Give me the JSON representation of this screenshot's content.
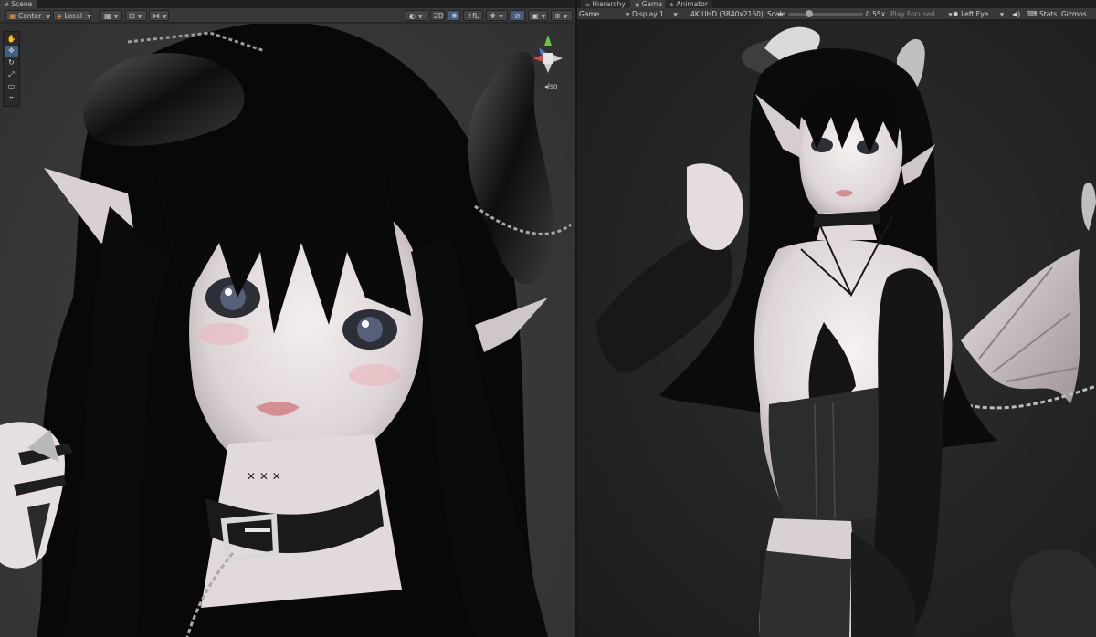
{
  "scene_tabbar": {
    "tab_scene": "Scene"
  },
  "scene_toolbar": {
    "pivot_label": "Center",
    "space_label": "Local",
    "mode_2d": "2D",
    "fx_label": "↑fL"
  },
  "gizmo": {
    "projection_label": "Iso"
  },
  "game_tabbar": {
    "tab_hierarchy": "Hierarchy",
    "tab_game": "Game",
    "tab_animator": "Animator"
  },
  "game_toolbar": {
    "view_mode": "Game",
    "display": "Display 1",
    "resolution": "4K UHD (3840x2160)",
    "scale_label": "Scale",
    "scale_value": "0.55x",
    "play_mode": "Play Focused",
    "eye": "Left Eye",
    "stats": "Stats",
    "gizmos": "Gizmos"
  },
  "colors": {
    "panel_bg": "#2b2b2b",
    "toolbar_bg": "#383838",
    "accent_active": "#3d5f85",
    "gizmo_y": "#6ec24a",
    "gizmo_x": "#d24a4a",
    "gizmo_z": "#4a7bd2"
  },
  "scale_level": 0.25
}
